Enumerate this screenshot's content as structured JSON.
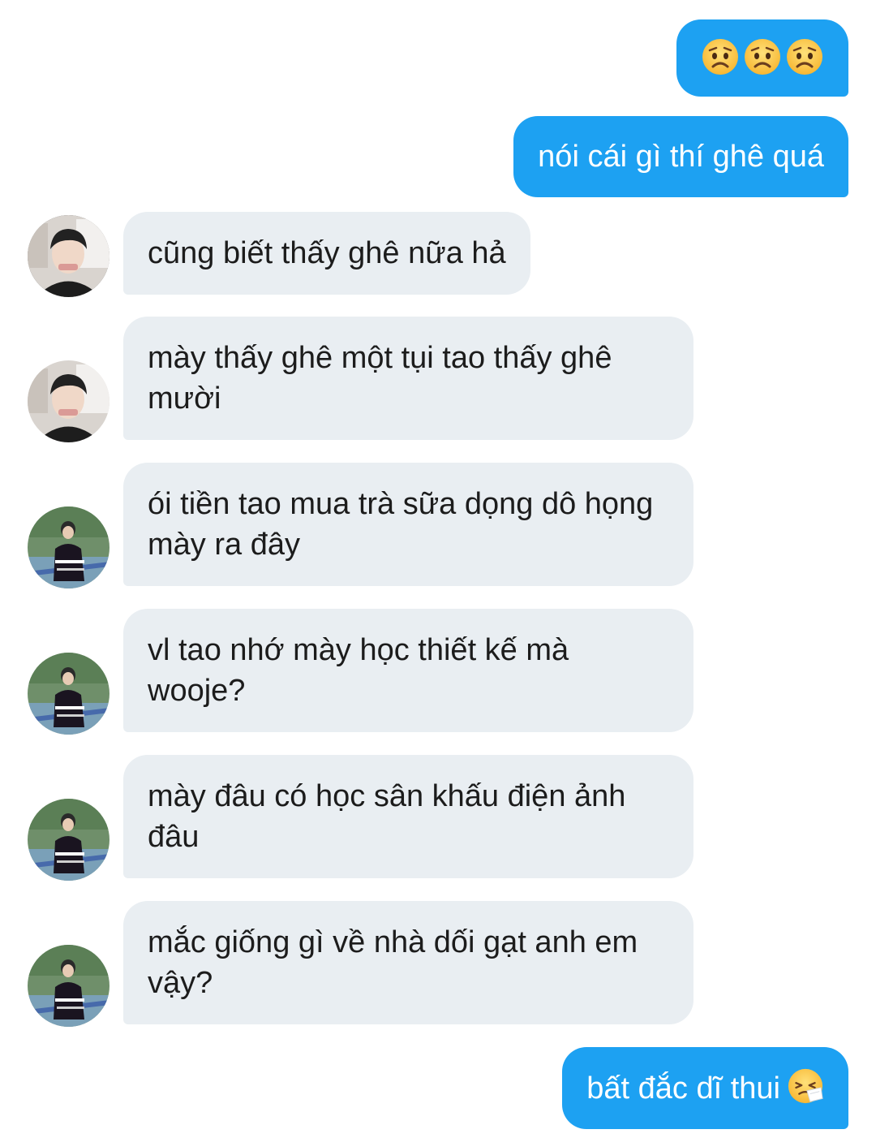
{
  "messages": [
    {
      "side": "sent",
      "text": "",
      "emojis": [
        "worried-face-icon",
        "worried-face-icon",
        "worried-face-icon"
      ]
    },
    {
      "side": "sent",
      "text": "nói cái gì thí ghê quá"
    },
    {
      "side": "received",
      "avatar": "avatar-1",
      "text": "cũng biết thấy ghê nữa hả"
    },
    {
      "side": "received",
      "avatar": "avatar-1",
      "text": "mày thấy ghê một tụi tao thấy ghê mười"
    },
    {
      "side": "received",
      "avatar": "avatar-2",
      "text": "ói tiền tao mua trà sữa dọng dô họng mày ra đây"
    },
    {
      "side": "received",
      "avatar": "avatar-2",
      "text": "vl tao nhớ mày học thiết kế mà wooje?"
    },
    {
      "side": "received",
      "avatar": "avatar-2",
      "text": "mày đâu có học sân khấu điện ảnh đâu"
    },
    {
      "side": "received",
      "avatar": "avatar-2",
      "text": "mắc giống gì về nhà dối gạt anh em vậy?"
    },
    {
      "side": "sent",
      "text": "bất đắc dĩ thui",
      "emoji": "sneezing-face-icon"
    }
  ],
  "colors": {
    "sent_bubble": "#1da1f2",
    "received_bubble": "#e9eef2",
    "sent_text": "#ffffff",
    "received_text": "#1c1c1c"
  }
}
